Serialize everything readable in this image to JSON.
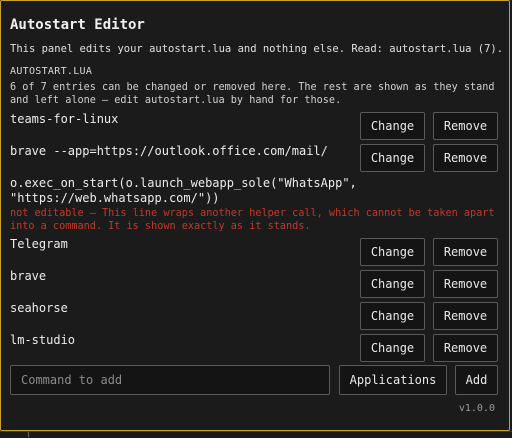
{
  "panel": {
    "title": "Autostart Editor",
    "description": "This panel edits your autostart.lua and nothing else. Read: autostart.lua (7).",
    "section_label": "AUTOSTART.LUA",
    "note": "6 of 7 entries can be changed or removed here. The rest are shown as they stand and left alone — edit autostart.lua by hand for those."
  },
  "entries": [
    {
      "command": "teams-for-linux"
    },
    {
      "command": "brave --app=https://outlook.office.com/mail/"
    },
    {
      "command": "o.exec_on_start(o.launch_webapp_sole(\"WhatsApp\", \"https://web.whatsapp.com/\"))",
      "error": "not editable — This line wraps another helper call, which cannot be taken apart into a command. It is shown exactly as it stands."
    },
    {
      "command": "Telegram"
    },
    {
      "command": "brave"
    },
    {
      "command": "seahorse"
    },
    {
      "command": "lm-studio"
    }
  ],
  "buttons": {
    "change": "Change",
    "remove": "Remove",
    "applications": "Applications",
    "add": "Add"
  },
  "input": {
    "placeholder": "Command to add"
  },
  "version": "v1.0.0"
}
